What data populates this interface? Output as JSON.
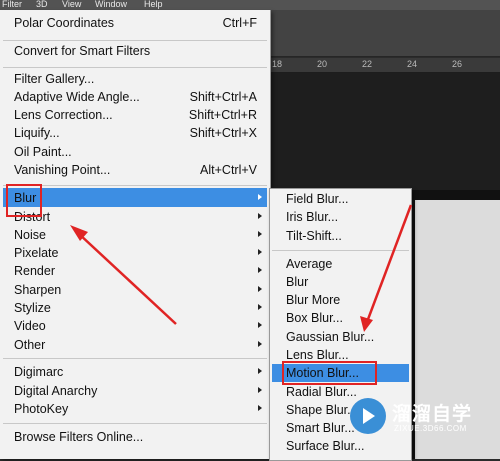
{
  "menubar": {
    "items": [
      "Filter",
      "3D",
      "View",
      "Window",
      "Help"
    ]
  },
  "ruler": {
    "ticks": [
      "18",
      "20",
      "22",
      "24",
      "26"
    ]
  },
  "filter_menu": {
    "last_filter": {
      "label": "Polar Coordinates",
      "shortcut": "Ctrl+F"
    },
    "convert": "Convert for Smart Filters",
    "items": [
      {
        "label": "Filter Gallery...",
        "shortcut": ""
      },
      {
        "label": "Adaptive Wide Angle...",
        "shortcut": "Shift+Ctrl+A"
      },
      {
        "label": "Lens Correction...",
        "shortcut": "Shift+Ctrl+R"
      },
      {
        "label": "Liquify...",
        "shortcut": "Shift+Ctrl+X"
      },
      {
        "label": "Oil Paint...",
        "shortcut": ""
      },
      {
        "label": "Vanishing Point...",
        "shortcut": "Alt+Ctrl+V"
      }
    ],
    "submenus": [
      "Blur",
      "Distort",
      "Noise",
      "Pixelate",
      "Render",
      "Sharpen",
      "Stylize",
      "Video",
      "Other"
    ],
    "plugins": [
      "Digimarc",
      "Digital Anarchy",
      "PhotoKey"
    ],
    "browse": "Browse Filters Online...",
    "highlighted": "Blur",
    "highlight_color": "#3d8ee3"
  },
  "blur_submenu": {
    "group1": [
      "Field Blur...",
      "Iris Blur...",
      "Tilt-Shift..."
    ],
    "group2": [
      "Average",
      "Blur",
      "Blur More",
      "Box Blur...",
      "Gaussian Blur...",
      "Lens Blur...",
      "Motion Blur...",
      "Radial Blur...",
      "Shape Blur...",
      "Smart Blur...",
      "Surface Blur..."
    ],
    "highlighted": "Motion Blur..."
  },
  "annotations": {
    "color": "#e02424"
  },
  "watermark": {
    "title": "溜溜自学",
    "subtitle": "ZIXUE.3D66.COM"
  }
}
